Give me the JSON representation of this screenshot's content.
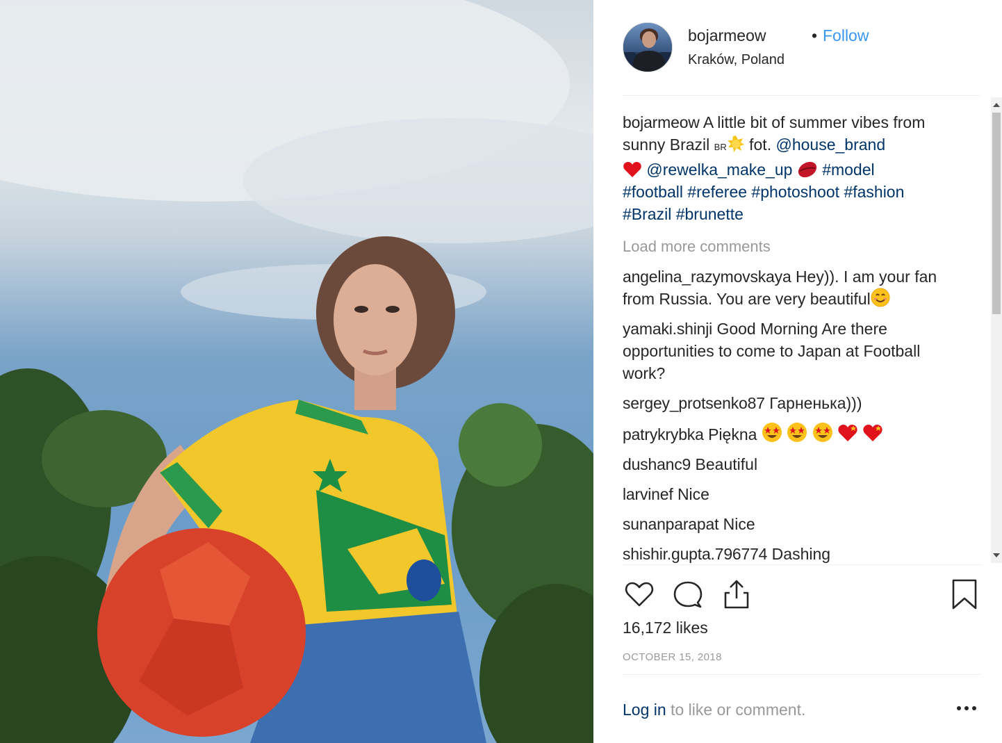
{
  "post": {
    "image_alt": "Woman in yellow Brazil football shirt holding a red football under a blue sky",
    "author": {
      "username": "bojarmeow",
      "separator": "•",
      "follow_label": "Follow",
      "location": "Kraków, Poland"
    },
    "caption": {
      "username": "bojarmeow",
      "text_1": "A little bit of summer vibes from sunny Brazil ",
      "flag_text": "BR",
      "text_2": " fot. ",
      "mention_1": "@house_brand",
      "mention_2": "@rewelka_make_up",
      "tags": [
        "#model",
        "#football",
        "#referee",
        "#photoshoot",
        "#fashion",
        "#Brazil",
        "#brunette"
      ]
    },
    "load_more_label": "Load more comments",
    "comments": [
      {
        "username": "angelina_razymovskaya",
        "text": "Hey)). I am your fan from Russia. You are very beautiful"
      },
      {
        "username": "yamaki.shinji",
        "text": "Good Morning Are there opportunities to come to Japan at Football work?"
      },
      {
        "username": "sergey_protsenko87",
        "text": "Гарненька)))"
      },
      {
        "username": "patrykrybka",
        "text": "Piękna "
      },
      {
        "username": "dushanc9",
        "text": "Beautiful"
      },
      {
        "username": "larvinef",
        "text": "Nice"
      },
      {
        "username": "sunanparapat",
        "text": "Nice"
      },
      {
        "username": "shishir.gupta.796774",
        "text": "Dashing"
      }
    ],
    "likes_label": "16,172 likes",
    "date": "OCTOBER 15, 2018",
    "login_link": "Log in",
    "login_suffix": " to like or comment.",
    "icons": {
      "like": "heart-icon",
      "comment": "comment-icon",
      "share": "share-icon",
      "save": "bookmark-icon",
      "more": "more-options-icon"
    },
    "colors": {
      "link": "#003569",
      "follow": "#3897f0",
      "muted": "#999999"
    }
  }
}
